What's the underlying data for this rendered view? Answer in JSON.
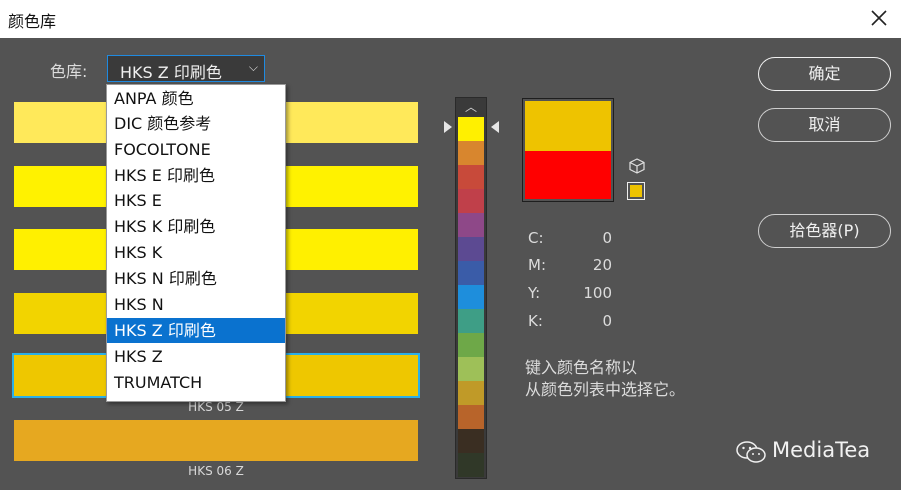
{
  "window": {
    "title": "颜色库"
  },
  "library": {
    "label": "色库:",
    "selected": "HKS Z 印刷色",
    "options": [
      "ANPA 颜色",
      "DIC 颜色参考",
      "FOCOLTONE",
      "HKS E 印刷色",
      "HKS E",
      "HKS K 印刷色",
      "HKS K",
      "HKS N 印刷色",
      "HKS N",
      "HKS Z 印刷色",
      "HKS Z",
      "TRUMATCH"
    ],
    "active_index": 9
  },
  "swatches": [
    {
      "color": "#FFE95A",
      "label": ""
    },
    {
      "color": "#FFF200",
      "label": ""
    },
    {
      "color": "#FFF000",
      "label": ""
    },
    {
      "color": "#F2D400",
      "label": ""
    },
    {
      "color": "#EEC700",
      "label": "HKS 05 Z",
      "selected": true
    },
    {
      "color": "#E6A820",
      "label": "HKS 06 Z"
    }
  ],
  "spectrum": [
    "#FFF000",
    "#D8862E",
    "#C84A3A",
    "#C0404A",
    "#8E4888",
    "#5C4A92",
    "#3A5CA8",
    "#1E8EDC",
    "#3E9E86",
    "#6EA848",
    "#9EC058",
    "#C09A28",
    "#B8642A",
    "#3A2E22",
    "#303828"
  ],
  "preview": {
    "new_color": "#EEC300",
    "old_color": "#FF0000"
  },
  "cmyk": [
    {
      "key": "C:",
      "value": "0"
    },
    {
      "key": "M:",
      "value": "20"
    },
    {
      "key": "Y:",
      "value": "100"
    },
    {
      "key": "K:",
      "value": "0"
    }
  ],
  "hint": {
    "line1": "键入颜色名称以",
    "line2": "从颜色列表中选择它。"
  },
  "buttons": {
    "ok": "确定",
    "cancel": "取消",
    "picker": "拾色器(P)"
  },
  "watermark": "MediaTea",
  "icons": {
    "close": "close-icon",
    "cube": "cube-icon",
    "chevron": "chevron-down-icon",
    "wechat": "wechat-icon"
  }
}
